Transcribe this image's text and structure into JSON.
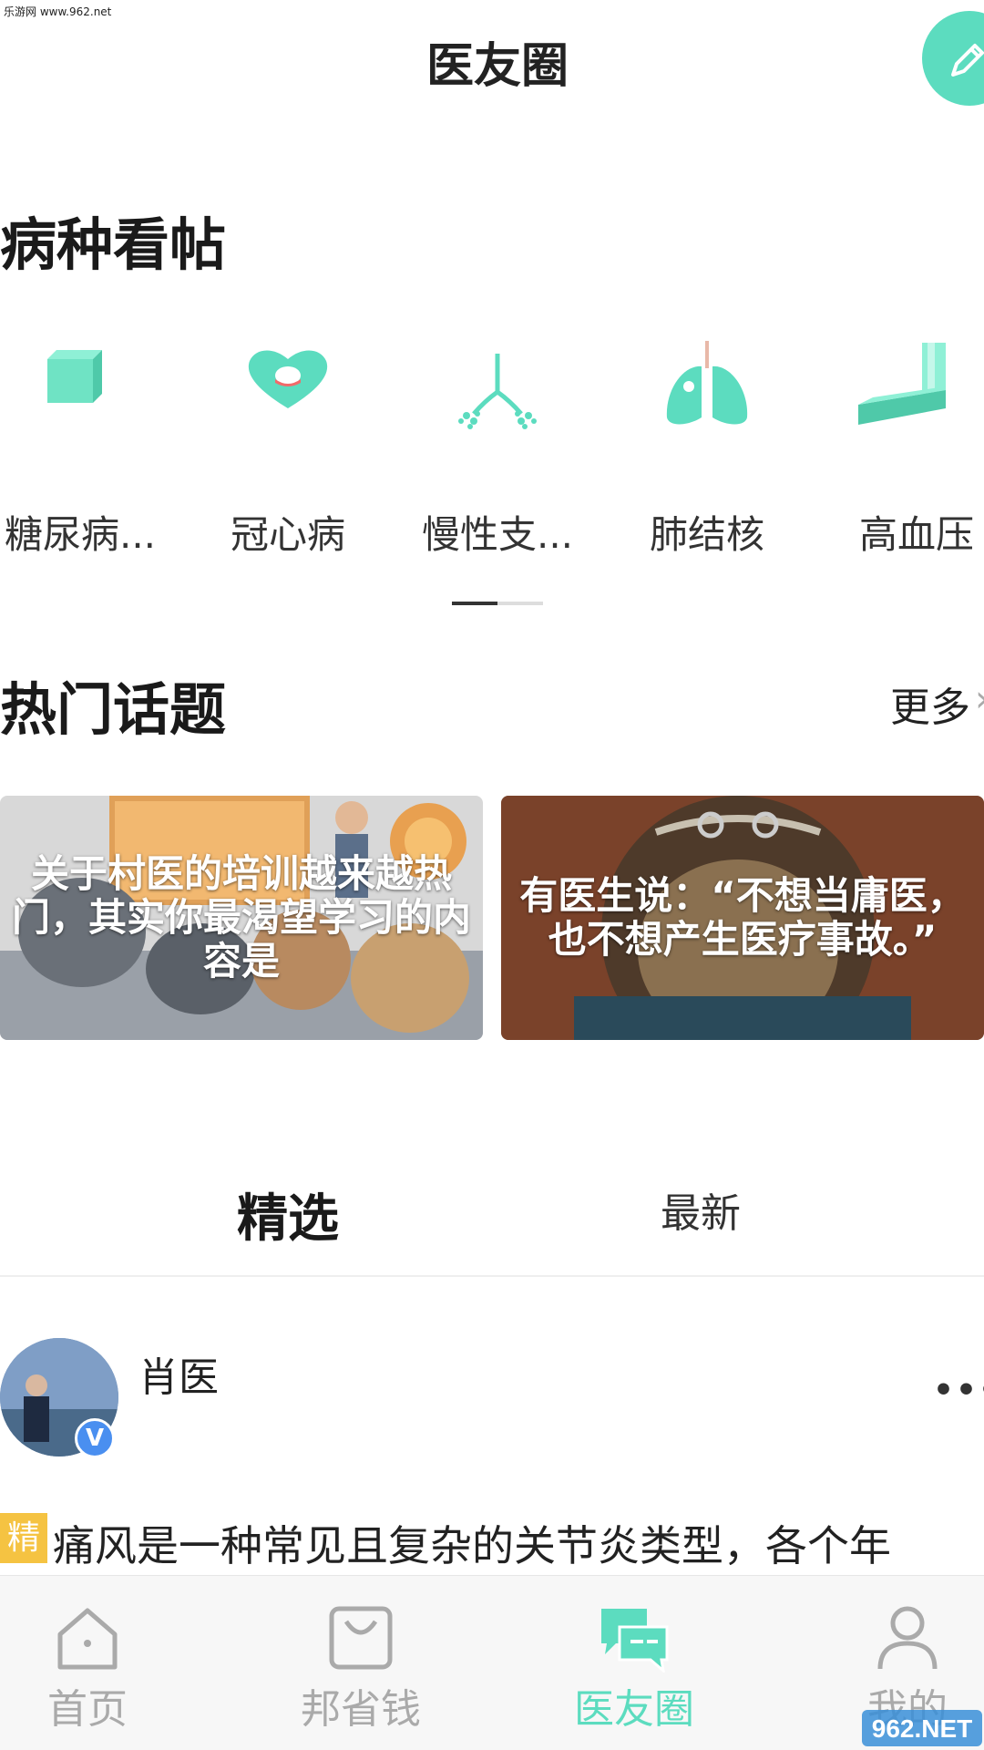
{
  "watermark": "乐游网 www.962.net",
  "header": {
    "title": "医友圈"
  },
  "disease_section": {
    "title": "病种看帖",
    "items": [
      {
        "label": "糖尿病...",
        "icon": "cube-icon"
      },
      {
        "label": "冠心病",
        "icon": "heart-icon"
      },
      {
        "label": "慢性支...",
        "icon": "bronchi-icon"
      },
      {
        "label": "肺结核",
        "icon": "lungs-icon"
      },
      {
        "label": "高血压",
        "icon": "bar-shape-icon"
      }
    ]
  },
  "topics_section": {
    "title": "热门话题",
    "more_label": "更多",
    "cards": [
      {
        "text": "关于村医的培训越来越热门，其实你最渴望学习的内容是"
      },
      {
        "text": "有医生说：“不想当庸医，也不想产生医疗事故。”"
      }
    ]
  },
  "feed_tabs": {
    "featured": "精选",
    "latest": "最新"
  },
  "post": {
    "author": "肖医",
    "verified_badge": "V",
    "tag": "精",
    "text": "痛风是一种常见且复杂的关节炎类型，各个年"
  },
  "bottom_nav": {
    "items": [
      {
        "label": "首页",
        "icon": "home-icon"
      },
      {
        "label": "邦省钱",
        "icon": "shopping-bag-icon"
      },
      {
        "label": "医友圈",
        "icon": "chat-bubbles-icon"
      },
      {
        "label": "我的",
        "icon": "user-icon"
      }
    ],
    "active_index": 2
  },
  "corner_logo": "962.NET",
  "colors": {
    "accent": "#5cdcbf",
    "verified": "#4a8ff0",
    "tag": "#f5c342",
    "nav_inactive": "#aaaaaa"
  }
}
